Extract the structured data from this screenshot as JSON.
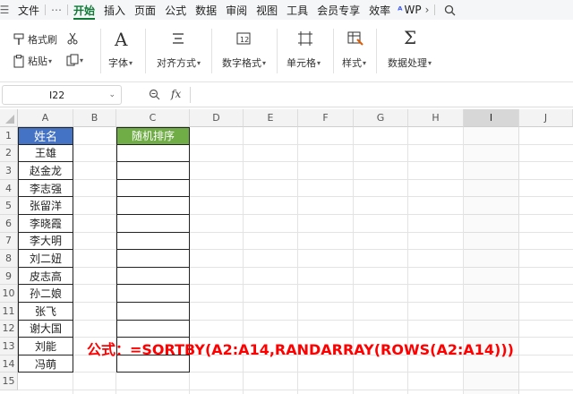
{
  "menubar": {
    "items": [
      "文件",
      "⋯",
      "开始",
      "插入",
      "页面",
      "公式",
      "数据",
      "审阅",
      "视图",
      "工具",
      "会员专享",
      "效率",
      "WP"
    ],
    "active": "开始"
  },
  "ribbon": {
    "format_painter": "格式刷",
    "paste": "粘贴",
    "font": "字体",
    "align": "对齐方式",
    "number_format": "数字格式",
    "cells": "单元格",
    "style": "样式",
    "data_process": "数据处理"
  },
  "formula_bar": {
    "name_box": "I22",
    "fx": "fx",
    "content": ""
  },
  "grid": {
    "columns": [
      "A",
      "B",
      "C",
      "D",
      "E",
      "F",
      "G",
      "H",
      "I",
      "J"
    ],
    "selected_column": "I",
    "rows": [
      "1",
      "2",
      "3",
      "4",
      "5",
      "6",
      "7",
      "8",
      "9",
      "10",
      "11",
      "12",
      "13",
      "14",
      "15"
    ],
    "header_a": "姓名",
    "header_c": "随机排序",
    "names": [
      "王雄",
      "赵金龙",
      "李志强",
      "张留洋",
      "李晓霞",
      "李大明",
      "刘二妞",
      "皮志高",
      "孙二娘",
      "张飞",
      "谢大国",
      "刘能",
      "冯萌"
    ],
    "formula_note": "公式：=SORTBY(A2:A14,RANDARRAY(ROWS(A2:A14)))"
  },
  "colors": {
    "header_a_bg": "#4472c4",
    "header_c_bg": "#70ad47",
    "annotation": "#ff0000",
    "accent": "#0e7a36"
  }
}
